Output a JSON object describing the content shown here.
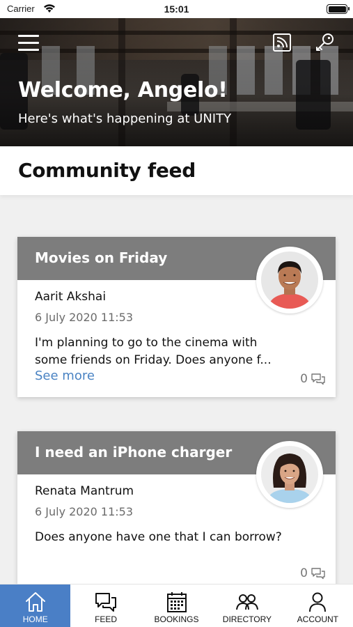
{
  "status_bar": {
    "carrier": "Carrier",
    "time": "15:01"
  },
  "header": {
    "welcome": "Welcome, Angelo!",
    "subtitle": "Here's what's happening at UNITY",
    "icons": [
      "menu-icon",
      "feed-icon",
      "key-icon"
    ]
  },
  "section": {
    "title": "Community feed"
  },
  "posts": [
    {
      "title": "Movies on Friday",
      "author": "Aarit Akshai",
      "date": "6 July 2020 11:53",
      "body": "I'm planning to go to the cinema with some friends on Friday. Does anyone f...",
      "see_more": "See more",
      "comments": "0"
    },
    {
      "title": "I need an iPhone charger",
      "author": "Renata Mantrum",
      "date": "6 July 2020 11:53",
      "body": "Does anyone have one that I can borrow?",
      "comments": "0"
    }
  ],
  "tabs": [
    {
      "label": "HOME",
      "icon": "home-icon",
      "active": true
    },
    {
      "label": "FEED",
      "icon": "chat-icon",
      "active": false
    },
    {
      "label": "BOOKINGS",
      "icon": "calendar-icon",
      "active": false
    },
    {
      "label": "DIRECTORY",
      "icon": "people-icon",
      "active": false
    },
    {
      "label": "ACCOUNT",
      "icon": "person-icon",
      "active": false
    }
  ],
  "colors": {
    "accent": "#4a7fc6",
    "card_header": "#7d7d7d",
    "link": "#4a83c3"
  }
}
